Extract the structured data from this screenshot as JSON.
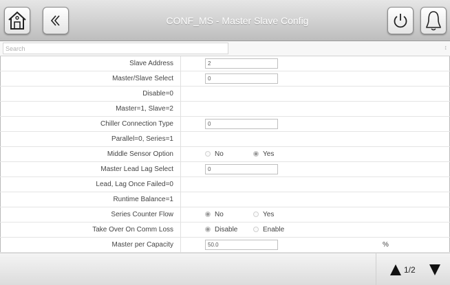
{
  "header": {
    "title": "CONF_MS - Master Slave Config",
    "home_icon": "home-icon",
    "back_icon": "double-chevron-left-icon",
    "power_icon": "power-icon",
    "alarm_icon": "bell-icon"
  },
  "search": {
    "placeholder": "Search",
    "sort_glyph": "↕"
  },
  "rows": [
    {
      "label": "Slave Address",
      "value": "2"
    },
    {
      "label": "Master/Slave Select",
      "value": "0"
    },
    {
      "label": "Disable=0"
    },
    {
      "label": "Master=1, Slave=2"
    },
    {
      "label": "Chiller Connection Type",
      "value": "0"
    },
    {
      "label": "Parallel=0, Series=1"
    },
    {
      "label": "Middle Sensor Option",
      "options": [
        "No",
        "Yes"
      ],
      "selected": "Yes"
    },
    {
      "label": "Master Lead Lag Select",
      "value": "0"
    },
    {
      "label": "Lead, Lag Once Failed=0"
    },
    {
      "label": "Runtime Balance=1"
    },
    {
      "label": "Series Counter Flow",
      "options": [
        "No",
        "Yes"
      ],
      "selected": "No"
    },
    {
      "label": "Take Over On Comm Loss",
      "options": [
        "Disable",
        "Enable"
      ],
      "selected": "Disable"
    },
    {
      "label": "Master per Capacity",
      "value": "50.0",
      "unit": "%"
    }
  ],
  "pager": {
    "label": "1/2",
    "up_icon": "triangle-up-icon",
    "down_icon": "triangle-down-icon"
  },
  "colors": {
    "header_top": "#e6e6e6",
    "header_bottom": "#bdbdbd",
    "title_text": "#ffffff"
  }
}
